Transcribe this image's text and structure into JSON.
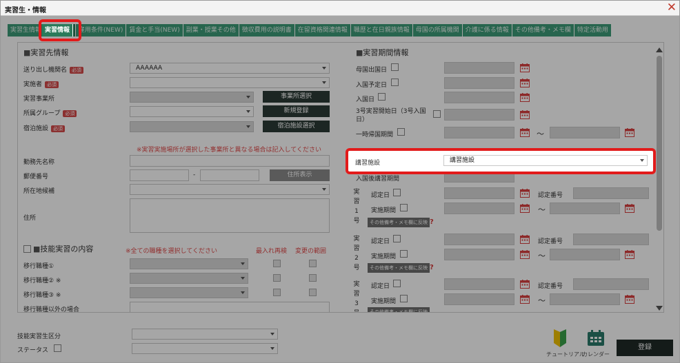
{
  "window": {
    "title": "実習生・情報"
  },
  "tabs": [
    {
      "label": "実習生情報"
    },
    {
      "label": "実習情報"
    },
    {
      "label": "雇用条件(NEW)"
    },
    {
      "label": "賃金と手当(NEW)"
    },
    {
      "label": "副業・授業その他"
    },
    {
      "label": "徴収費用の説明書"
    },
    {
      "label": "在留資格関連情報"
    },
    {
      "label": "職歴と在日親族情報"
    },
    {
      "label": "母国の所属機関"
    },
    {
      "label": "介護に係る情報"
    },
    {
      "label": "その他備考・メモ欄"
    },
    {
      "label": "特定活動用"
    }
  ],
  "left": {
    "section_title": "実習先情報",
    "required_badge": "必須",
    "rows": {
      "sending_org": {
        "label": "送り出し機関名",
        "value": "AAAAAA"
      },
      "implementer": {
        "label": "実施者",
        "value": ""
      },
      "office": {
        "label": "実習事業所",
        "value": ""
      },
      "group": {
        "label": "所属グループ",
        "value": ""
      },
      "lodging": {
        "label": "宿泊施設",
        "value": ""
      }
    },
    "buttons": {
      "office_select": "事業所選択",
      "new_register": "新規登録",
      "lodging_select": "宿泊施設選択"
    },
    "note_address": "※実習実施場所が選択した事業所と異なる場合は記入してください",
    "workplace_label": "勤務先名称",
    "postal_label": "郵便番号",
    "postal_dash": "-",
    "address_display": "住所表示",
    "prefecture_label": "所在地候補",
    "address_label": "住所",
    "skill_title": "技能実習の内容",
    "skill_note": "※全ての職種を選択してください",
    "col_switch": "最入れ再検",
    "col_change": "変更の範囲",
    "job1": "移行職種①",
    "job2": "移行職種② ※",
    "job3": "移行職種③ ※",
    "job_other": "移行職種以外の場合"
  },
  "right": {
    "section_title": "実習期間情報",
    "home_departure": "母国出国日",
    "entry_planned": "入国予定日",
    "entry_date": "入国日",
    "start_3go": "3号実習開始日（3号入国日）",
    "temp_return": "一時帰国期間",
    "tilde": "〜",
    "lecture_label": "講習施設",
    "lecture_value": "講習施設",
    "post_lecture": "入国後講習期間",
    "cert_date": "認定日",
    "cert_no": "認定番号",
    "impl_period": "実施期間",
    "memo_btn": "その他備考・メモ欄に反映",
    "q": "?",
    "blocks": [
      {
        "v1": "実",
        "v2": "習",
        "v3": "1",
        "v4": "号"
      },
      {
        "v1": "実",
        "v2": "習",
        "v3": "2",
        "v4": "号"
      },
      {
        "v1": "実",
        "v2": "習",
        "v3": "3",
        "v4": "号"
      }
    ]
  },
  "bottom": {
    "trainee_class": "技能実習生区分",
    "status": "ステータス",
    "tutorial": "チュートリアル",
    "calendar": "カレンダー",
    "register": "登録"
  },
  "colors": {
    "tab": "#3c9c78",
    "tab_active": "#2a7a5a",
    "highlight": "#e21b1b",
    "required": "#d64a4a",
    "calendar": "#d94040"
  }
}
